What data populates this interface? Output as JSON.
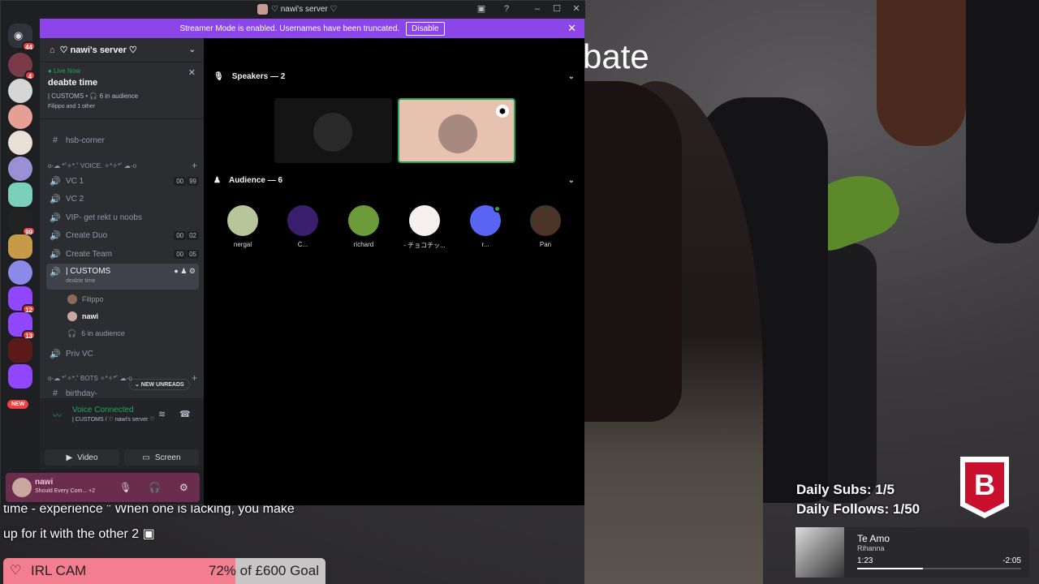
{
  "stream": {
    "overlay_word": "bate",
    "caption_line1": "time - experience \" When one is lacking, you make",
    "caption_line2": "up for it with the other 2",
    "goal": {
      "title": "IRL CAM",
      "amount": "72% of £600 Goal",
      "progress_percent": 72
    },
    "stats": {
      "subs": "Daily Subs: 1/5",
      "follows": "Daily Follows: 1/50"
    },
    "logo_letter": "B",
    "music": {
      "title": "Te Amo",
      "artist": "Rihanna",
      "current": "1:23",
      "remaining": "-2:05",
      "progress_fraction": 0.4
    }
  },
  "window": {
    "title": "♡ nawi's server ♡",
    "controls": {
      "minimize": "–",
      "maximize": "☐",
      "close": "✕"
    }
  },
  "banner": {
    "text": "Streamer Mode is enabled. Usernames have been truncated.",
    "disable_label": "Disable",
    "close": "✕"
  },
  "rail": {
    "badges": [
      "44",
      "4",
      "12",
      "13",
      "99"
    ],
    "new_label": "NEW"
  },
  "sidebar": {
    "server_name": "♡ nawi's server ♡",
    "live": {
      "status": "Live Now",
      "title": "deabte time",
      "meta": "| CUSTOMS • 🎧 6 in audience",
      "sub": "Filippo and 1 other"
    },
    "channels": [
      {
        "prefix": "#",
        "label": "hsb-corner"
      },
      {
        "prefix": "",
        "label": "o-☁ *˚✧*.˚ VOICE. ✧*✧*˚ ☁-o"
      },
      {
        "prefix": "🔊",
        "label": "VC 1",
        "c1": "00",
        "c2": "99"
      },
      {
        "prefix": "🔊",
        "label": "VC 2"
      },
      {
        "prefix": "🔊",
        "label": "VIP- get rekt u noobs"
      },
      {
        "prefix": "🔊",
        "label": "Create Duo",
        "c1": "00",
        "c2": "02"
      },
      {
        "prefix": "🔊",
        "label": "Create Team",
        "c1": "00",
        "c2": "05"
      },
      {
        "prefix": "🔊",
        "label": "| CUSTOMS",
        "sub": "deabte time"
      },
      {
        "prefix": "🔊",
        "label": "Priv VC"
      },
      {
        "prefix": "",
        "label": "o-☁ *˚✧*.˚ BOTS ✧*✧*˚ ☁-o"
      },
      {
        "prefix": "#",
        "label": "birthday-"
      }
    ],
    "members": [
      "Filippo",
      "nawi",
      "6 in audience"
    ],
    "new_unreads": "⌄ NEW UNREADS"
  },
  "voice": {
    "status": "Voice Connected",
    "location": "| CUSTOMS / ♡ nawi's server ♡",
    "video_label": "Video",
    "screen_label": "Screen"
  },
  "user": {
    "name": "nawi",
    "status": "Should Every Com... +2"
  },
  "main": {
    "speakers_label": "Speakers — 2",
    "audience_label": "Audience — 6",
    "audience": [
      {
        "name": "nergal",
        "color": "#b7c59a"
      },
      {
        "name": "C...",
        "color": "#3a1f6e"
      },
      {
        "name": "richard",
        "color": "#6c9b3a"
      },
      {
        "name": "- チョコチッ...",
        "color": "#f5f0ee"
      },
      {
        "name": "r...",
        "color": "#5865f2"
      },
      {
        "name": "Pan",
        "color": "#4a3528"
      }
    ]
  },
  "colors": {
    "discord_bg": "#1e1f22",
    "sidebar_bg": "#2b2d31",
    "banner": "#8b45e8",
    "online": "#23a55a",
    "goal_pink": "#f37e8f"
  }
}
